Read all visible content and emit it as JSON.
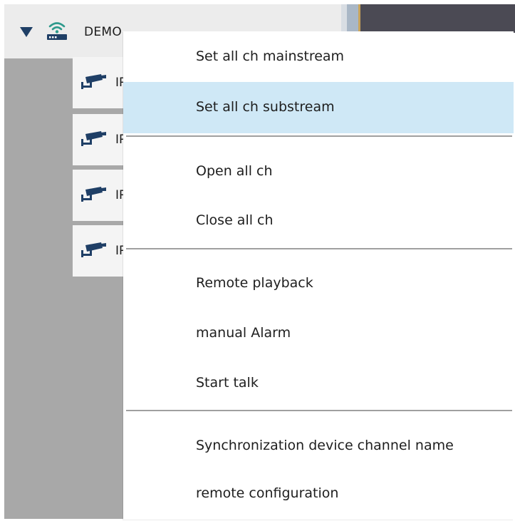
{
  "device_tree": {
    "device_label": "DEMO",
    "channels": [
      {
        "label": "IP"
      },
      {
        "label": "IP"
      },
      {
        "label": "IP"
      },
      {
        "label": "IP"
      }
    ]
  },
  "context_menu": {
    "items": [
      {
        "label": "Set all ch mainstream"
      },
      {
        "label": "Set all ch substream",
        "highlighted": true
      },
      {
        "label": "Open all ch"
      },
      {
        "label": "Close all ch"
      },
      {
        "label": "Remote playback"
      },
      {
        "label": "manual Alarm"
      },
      {
        "label": "Start talk"
      },
      {
        "label": "Synchronization device channel name"
      },
      {
        "label": "remote configuration"
      }
    ]
  },
  "colors": {
    "highlight": "#cfe8f6",
    "tree_background": "#a8a8a8",
    "device_icon": "#2e9a8c",
    "camera_icon": "#1f3f66"
  },
  "icons": {
    "expand": "triangle-down-icon",
    "device": "wifi-router-icon",
    "channel": "ip-camera-icon"
  }
}
